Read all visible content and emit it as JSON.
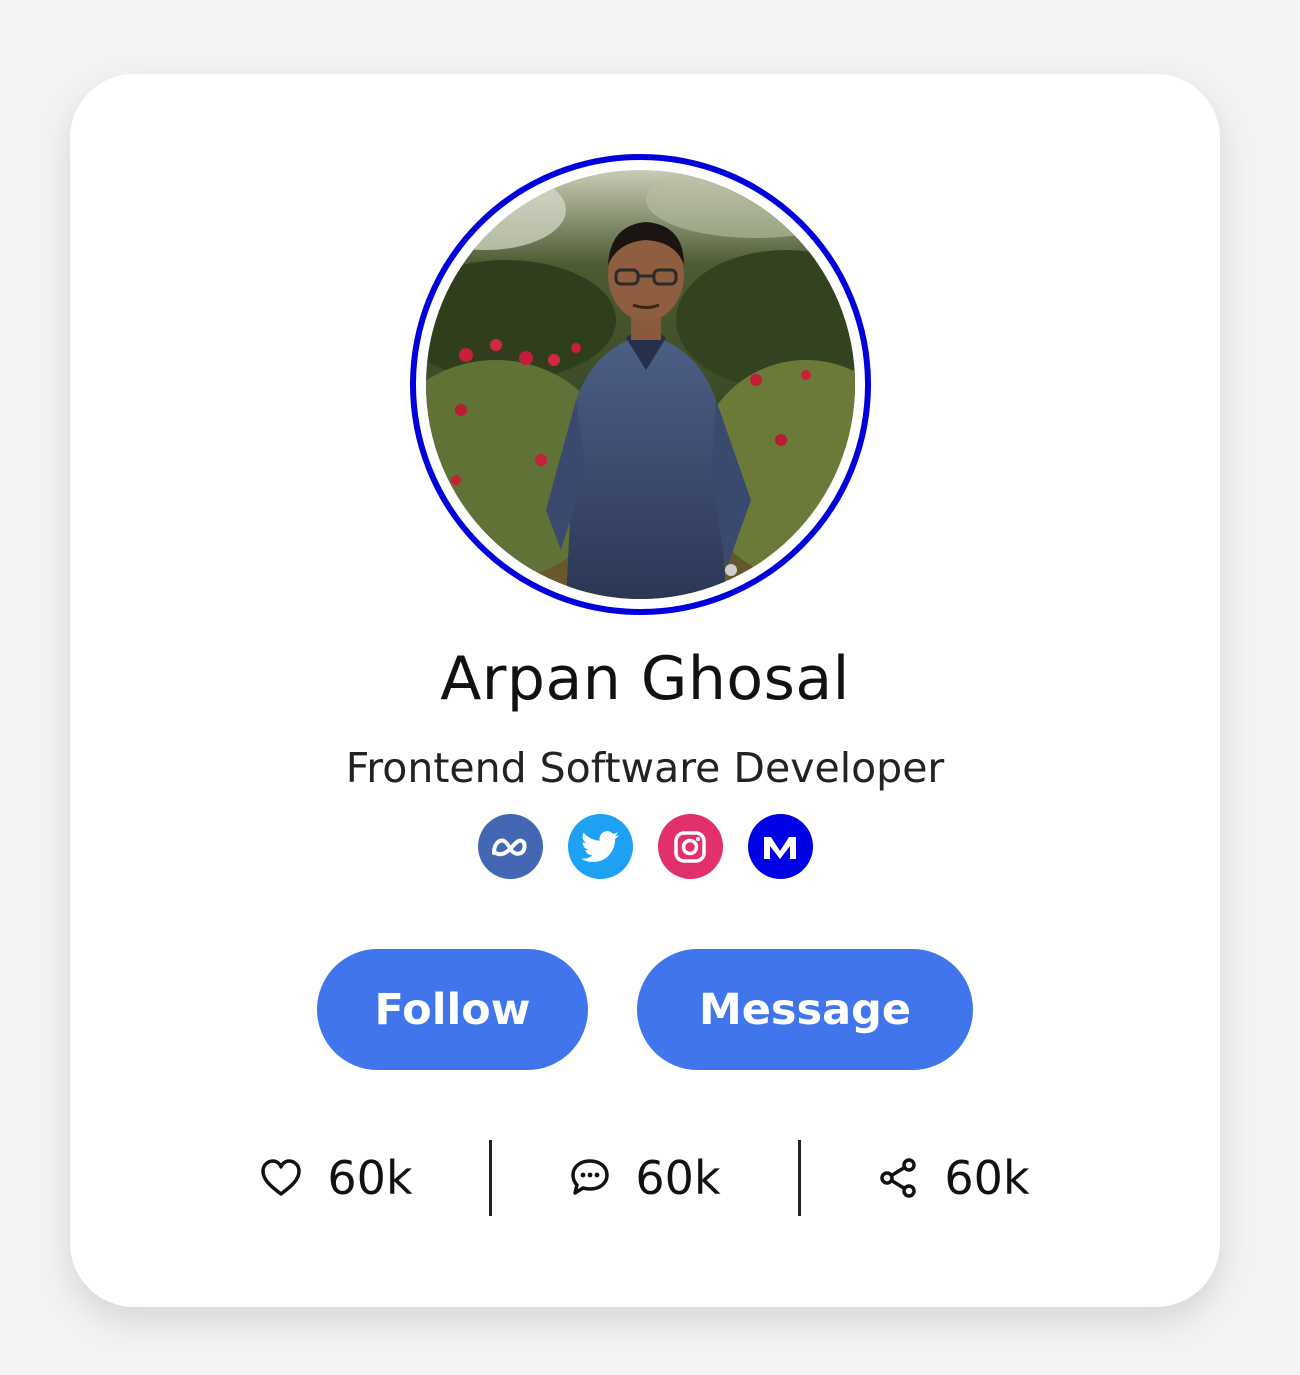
{
  "profile": {
    "name": "Arpan Ghosal",
    "role": "Frontend Software Developer",
    "ring_color": "#0000dd"
  },
  "socials": [
    {
      "name": "meta",
      "icon": "meta-icon",
      "color": "#4367b3"
    },
    {
      "name": "twitter",
      "icon": "twitter-icon",
      "color": "#1da1f2"
    },
    {
      "name": "instagram",
      "icon": "instagram-icon",
      "color": "#e1306c"
    },
    {
      "name": "medium",
      "icon": "medium-icon",
      "color": "#0000e6"
    }
  ],
  "actions": {
    "follow_label": "Follow",
    "message_label": "Message",
    "button_color": "#4075ec"
  },
  "stats": {
    "likes": {
      "icon": "heart-icon",
      "value": "60k"
    },
    "comments": {
      "icon": "comment-icon",
      "value": "60k"
    },
    "shares": {
      "icon": "share-icon",
      "value": "60k"
    }
  }
}
